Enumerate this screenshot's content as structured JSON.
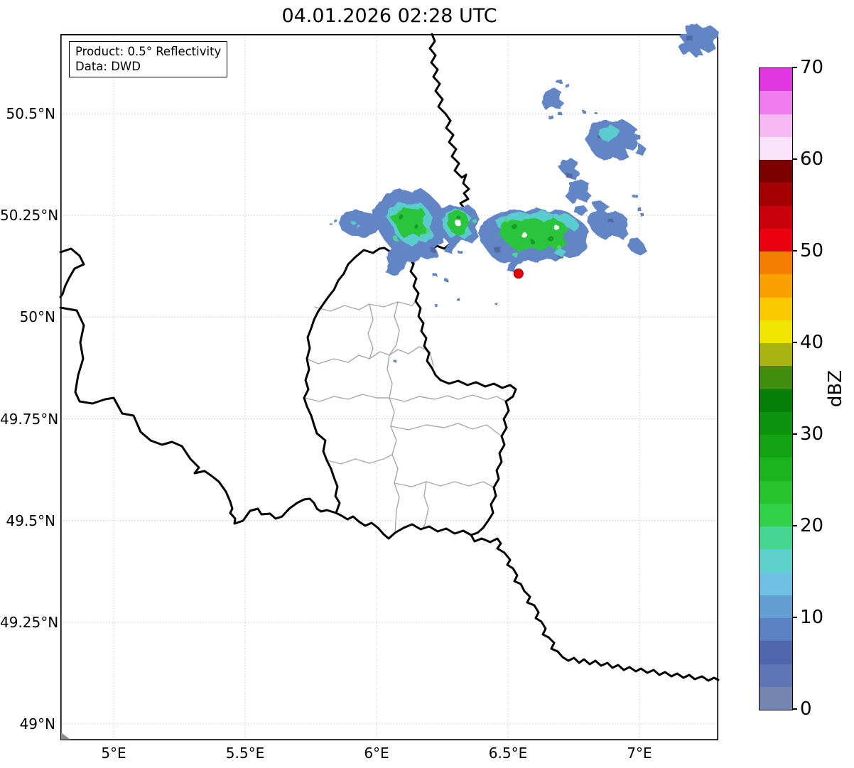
{
  "title": "04.01.2026 02:28 UTC",
  "info_box": {
    "line1": "Product: 0.5° Reflectivity",
    "line2": "Data: DWD"
  },
  "axes": {
    "x_ticks": [
      {
        "label": "5°E",
        "lon": 5.0
      },
      {
        "label": "5.5°E",
        "lon": 5.5
      },
      {
        "label": "6°E",
        "lon": 6.0
      },
      {
        "label": "6.5°E",
        "lon": 6.5
      },
      {
        "label": "7°E",
        "lon": 7.0
      }
    ],
    "y_ticks": [
      {
        "label": "50.5°N",
        "lat": 50.5
      },
      {
        "label": "50.25°N",
        "lat": 50.25
      },
      {
        "label": "50°N",
        "lat": 50.0
      },
      {
        "label": "49.75°N",
        "lat": 49.75
      },
      {
        "label": "49.5°N",
        "lat": 49.5
      },
      {
        "label": "49.25°N",
        "lat": 49.25
      },
      {
        "label": "49°N",
        "lat": 49.0
      }
    ],
    "extent": {
      "lon_min": 4.8,
      "lon_max": 7.29,
      "lat_min": 48.96,
      "lat_max": 50.7
    }
  },
  "colorbar": {
    "label": "dBZ",
    "vmin": 0,
    "vmax": 70,
    "segment_step": 2.5,
    "ticks": [
      0,
      10,
      20,
      30,
      40,
      50,
      60,
      70
    ],
    "colors_bottom_to_top": [
      "#7586b3",
      "#5f74b2",
      "#4f66ae",
      "#5b82c4",
      "#649dd2",
      "#6fc0e2",
      "#5ed0cb",
      "#47d592",
      "#31d148",
      "#26c32f",
      "#1cb220",
      "#13a213",
      "#0d930d",
      "#067f06",
      "#3f8c0e",
      "#a8b313",
      "#f0e400",
      "#fcc800",
      "#faa000",
      "#f57d00",
      "#ea0010",
      "#c9000a",
      "#a40004",
      "#7c0000",
      "#fbe3fb",
      "#f6b9f3",
      "#ee7cee",
      "#e136e1"
    ]
  },
  "map": {
    "radar_site": {
      "lon": 6.54,
      "lat": 50.107
    },
    "echo_clusters": [
      {
        "lon": 6.1,
        "lat": 50.22,
        "max_dbz": 30
      },
      {
        "lon": 6.3,
        "lat": 50.2,
        "max_dbz": 27
      },
      {
        "lon": 6.55,
        "lat": 50.18,
        "max_dbz": 30
      },
      {
        "lon": 6.9,
        "lat": 50.3,
        "max_dbz": 15
      },
      {
        "lon": 6.75,
        "lat": 50.45,
        "max_dbz": 12
      },
      {
        "lon": 7.15,
        "lat": 50.65,
        "max_dbz": 10
      }
    ]
  },
  "colors": {
    "frame": "#000000",
    "grid": "#c9c9c9",
    "national_border": "#000000",
    "admin_border": "#a8a8a8",
    "land_patch": "#8c8c8c",
    "echo_blue": "#6285c6",
    "echo_blue_dark": "#52679f",
    "echo_cyan": "#5accce",
    "echo_teal": "#4fd0a0",
    "echo_green": "#2cc53c",
    "echo_green_dark": "#139b26",
    "echo_green_light": "#55d36a",
    "hole_white": "#ffffff",
    "radar_site": "#e50000",
    "radar_site_edge": "#990000"
  }
}
